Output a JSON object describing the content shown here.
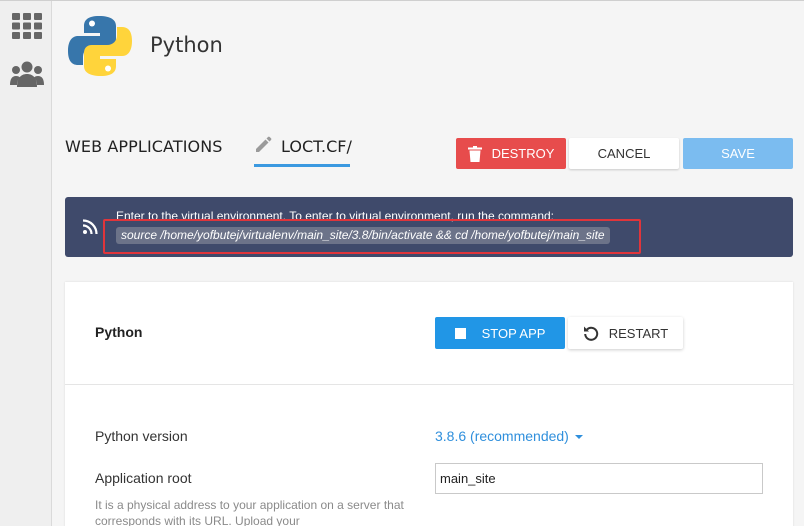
{
  "app": {
    "title": "Python"
  },
  "rail": {
    "icons": [
      "grid-icon",
      "users-icon"
    ]
  },
  "tabs": {
    "web_applications": "WEB APPLICATIONS",
    "domain": "LOCT.CF/"
  },
  "actions": {
    "destroy": "DESTROY",
    "cancel": "CANCEL",
    "save": "SAVE"
  },
  "banner": {
    "text": "Enter to the virtual environment. To enter to virtual environment, run the command:",
    "command": "source /home/yofbutej/virtualenv/main_site/3.8/bin/activate && cd /home/yofbutej/main_site"
  },
  "card": {
    "title": "Python",
    "stop": "STOP APP",
    "restart": "RESTART",
    "version_label": "Python version",
    "version_value": "3.8.6 (recommended)",
    "root_label": "Application root",
    "root_value": "main_site",
    "help": "It is a physical address to your application on a server that corresponds with its URL. Upload your"
  },
  "colors": {
    "destroy": "#e74c4c",
    "save": "#7bbcf0",
    "primary": "#2196e6",
    "banner": "#3f4a6b",
    "highlight": "#e0353b"
  }
}
